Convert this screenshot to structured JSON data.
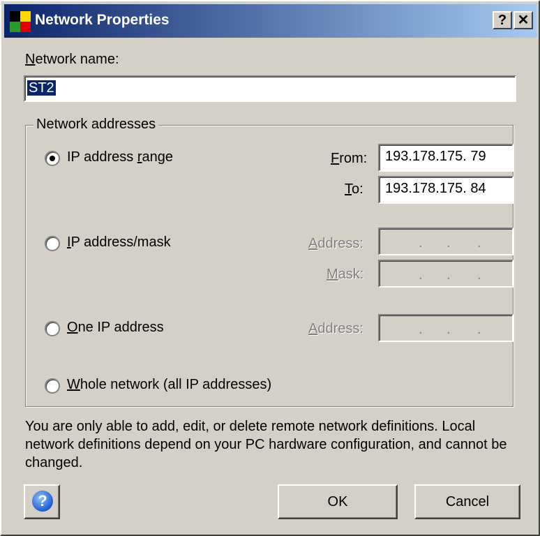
{
  "window": {
    "title": "Network Properties",
    "help_button": "?",
    "close_button": "✕"
  },
  "network_name": {
    "label": "Network name:",
    "value": "ST2"
  },
  "addresses": {
    "group_label": "Network addresses",
    "ip_range": {
      "label": "IP address range",
      "selected": true,
      "from_label": "From:",
      "from_value": "193.178.175. 79",
      "to_label": "To:",
      "to_value": "193.178.175. 84"
    },
    "ip_mask": {
      "label": "IP address/mask",
      "address_label": "Address:",
      "mask_label": "Mask:"
    },
    "one_ip": {
      "label": "One IP address",
      "address_label": "Address:"
    },
    "whole_network": {
      "label": "Whole network (all IP addresses)"
    }
  },
  "note": "You are only able to add, edit, or delete remote network definitions. Local network definitions depend on your PC hardware configuration, and cannot be changed.",
  "buttons": {
    "ok": "OK",
    "cancel": "Cancel"
  },
  "icons": {
    "app": "network-properties-icon",
    "help": "help-icon"
  }
}
